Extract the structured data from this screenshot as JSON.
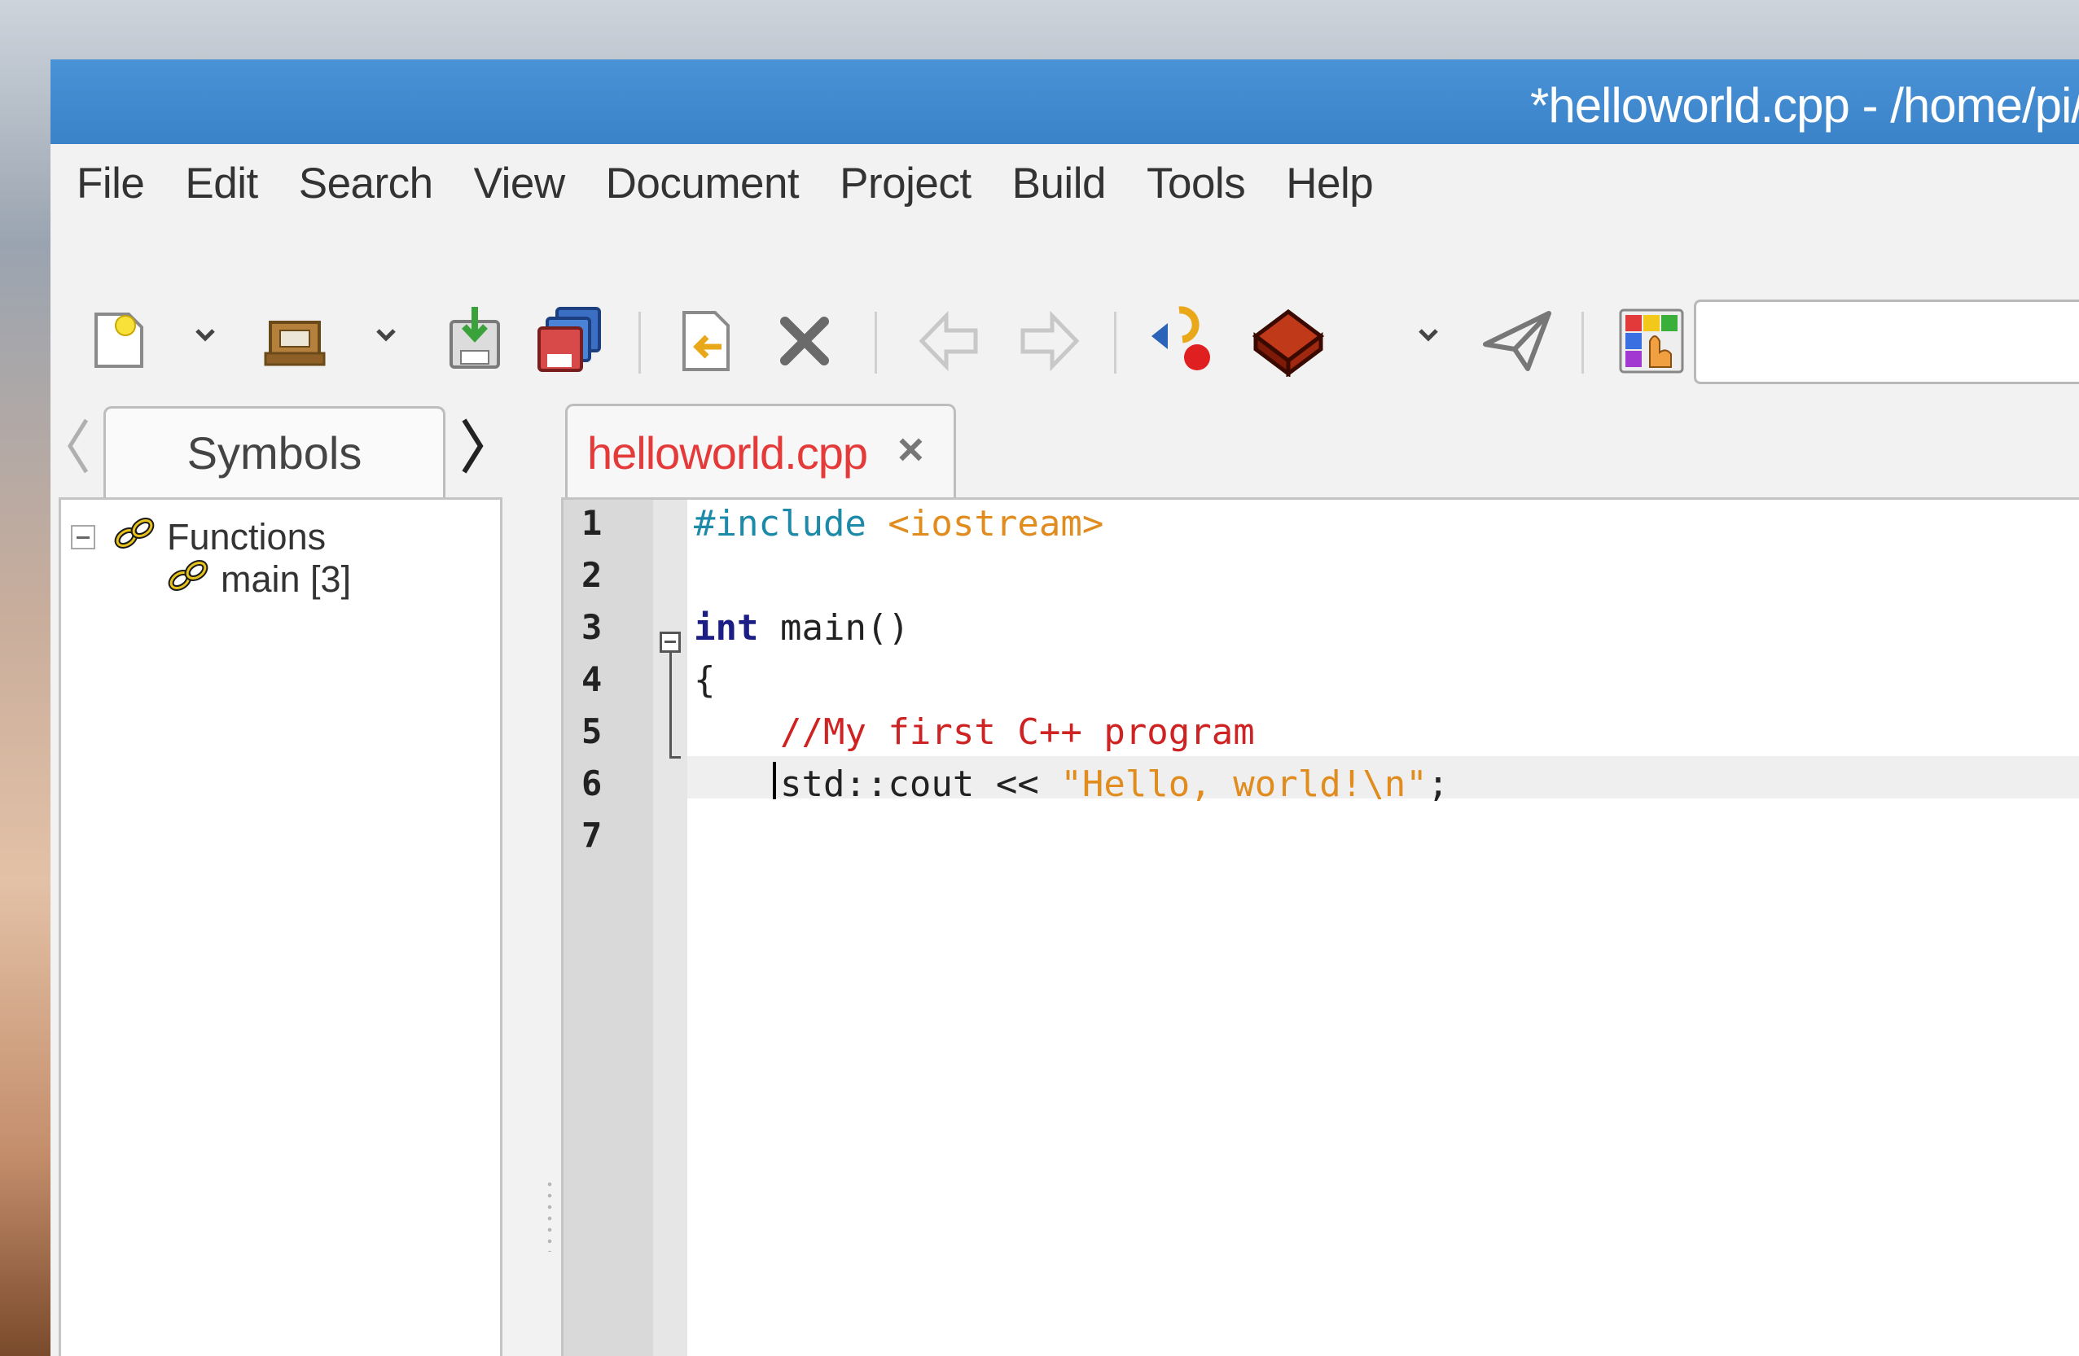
{
  "window": {
    "title": "*helloworld.cpp - /home/pi/"
  },
  "menubar": {
    "items": [
      {
        "label": "File"
      },
      {
        "label": "Edit"
      },
      {
        "label": "Search"
      },
      {
        "label": "View"
      },
      {
        "label": "Document"
      },
      {
        "label": "Project"
      },
      {
        "label": "Build"
      },
      {
        "label": "Tools"
      },
      {
        "label": "Help"
      }
    ]
  },
  "toolbar": {
    "icons": [
      "new-file-icon",
      "chevron-down-icon",
      "open-file-icon",
      "chevron-down-icon",
      "save-icon",
      "save-all-icon",
      "revert-icon",
      "close-icon",
      "back-arrow-icon",
      "forward-arrow-icon",
      "compile-icon",
      "build-icon",
      "chevron-down-icon",
      "run-icon",
      "color-chooser-icon"
    ],
    "search_value": ""
  },
  "sidebar": {
    "tab_label": "Symbols",
    "tree": [
      {
        "label": "Functions",
        "expanded": true,
        "children": [
          {
            "label": "main [3]"
          }
        ]
      }
    ]
  },
  "editor": {
    "tab_label": "helloworld.cpp",
    "tab_close": "×",
    "line_numbers": [
      "1",
      "2",
      "3",
      "4",
      "5",
      "6",
      "7"
    ],
    "current_line": 7,
    "lines": [
      {
        "tokens": [
          {
            "text": "#include",
            "style": "kw"
          },
          {
            "text": " ",
            "style": "punc"
          },
          {
            "text": "<iostream>",
            "style": "str"
          }
        ]
      },
      {
        "tokens": []
      },
      {
        "tokens": [
          {
            "text": "int",
            "style": "type"
          },
          {
            "text": " main()",
            "style": "punc"
          }
        ]
      },
      {
        "tokens": [
          {
            "text": "{",
            "style": "punc"
          }
        ]
      },
      {
        "tokens": [
          {
            "text": "    ",
            "style": "punc"
          },
          {
            "text": "//My first C++ program",
            "style": "com"
          }
        ]
      },
      {
        "tokens": [
          {
            "text": "    std::cout << ",
            "style": "punc"
          },
          {
            "text": "\"Hello, world!\\n\"",
            "style": "str"
          },
          {
            "text": ";",
            "style": "punc"
          }
        ]
      },
      {
        "tokens": []
      }
    ]
  },
  "colors": {
    "titlebar": "#3a83c9",
    "tab_text": "#e53a3a",
    "keyword": "#1c8aa8",
    "string": "#e08c1e",
    "type": "#1d1d86",
    "comment": "#cf2222"
  }
}
